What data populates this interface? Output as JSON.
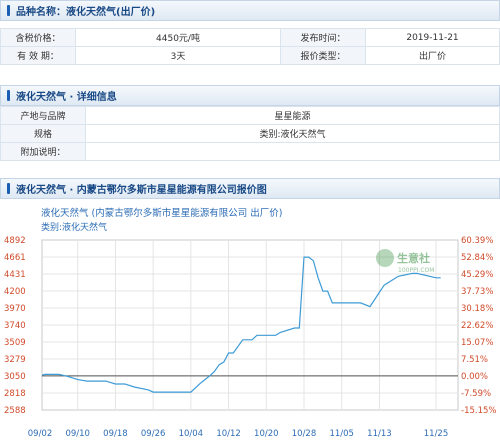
{
  "section1": {
    "title": "品种名称：液化天然气(出厂价)",
    "rows": [
      {
        "label1": "含税价格：",
        "value1": "4450元/吨",
        "label2": "发布时间：",
        "value2": "2019-11-21"
      },
      {
        "label1": "有 效 期：",
        "value1": "3天",
        "label2": "报价类型：",
        "value2": "出厂价"
      }
    ]
  },
  "section2": {
    "title": "液化天然气 · 详细信息",
    "rows": [
      {
        "label": "产地与品牌",
        "value": "星星能源"
      },
      {
        "label": "规格",
        "value": "类别:液化天然气"
      },
      {
        "label": "附加说明：",
        "value": ""
      }
    ]
  },
  "section3": {
    "title": "液化天然气 · 内蒙古鄂尔多斯市星星能源有限公司报价图"
  },
  "chart_data": {
    "type": "line",
    "title": "液化天然气 (内蒙古鄂尔多斯市星星能源有限公司 出厂价)",
    "subtitle": "类别:液化天然气",
    "watermark": "生意社",
    "watermark_url": "100PPI.COM",
    "x_ticks": [
      "09/02",
      "09/10",
      "09/18",
      "09/26",
      "10/04",
      "10/12",
      "10/20",
      "10/28",
      "11/05",
      "11/13",
      "11/25"
    ],
    "y_left_ticks": [
      "4892",
      "4661",
      "4431",
      "4200",
      "3970",
      "3740",
      "3509",
      "3279",
      "3050",
      "2818",
      "2588"
    ],
    "y_right_ticks": [
      "60.39%",
      "52.84%",
      "45.29%",
      "37.73%",
      "30.18%",
      "22.62%",
      "15.07%",
      "7.51%",
      "0.00%",
      "-7.59%",
      "-15.15%"
    ],
    "ylim": [
      2588,
      4892
    ],
    "series": [
      {
        "color": "#3d9bd6",
        "x": [
          "09/01",
          "09/03",
          "09/06",
          "09/08",
          "09/10",
          "09/12",
          "09/16",
          "09/18",
          "09/20",
          "09/22",
          "09/25",
          "09/26",
          "10/04",
          "10/06",
          "10/08",
          "10/09",
          "10/10",
          "10/11",
          "10/12",
          "10/13",
          "10/15",
          "10/17",
          "10/18",
          "10/22",
          "10/23",
          "10/26",
          "10/27",
          "10/28",
          "10/29",
          "10/30",
          "10/31",
          "11/01",
          "11/02",
          "11/03",
          "11/09",
          "11/11",
          "11/14",
          "11/17",
          "11/20",
          "11/21",
          "11/25",
          "11/26"
        ],
        "y": [
          3060,
          3070,
          3070,
          3040,
          3000,
          2980,
          2980,
          2940,
          2940,
          2900,
          2860,
          2830,
          2830,
          2950,
          3050,
          3110,
          3200,
          3240,
          3360,
          3360,
          3540,
          3540,
          3600,
          3600,
          3640,
          3700,
          3700,
          4660,
          4660,
          4610,
          4380,
          4200,
          4200,
          4040,
          4040,
          3990,
          4280,
          4400,
          4440,
          4440,
          4380,
          4380
        ]
      }
    ]
  },
  "colors": {
    "accent": "#1a5fb4",
    "left_axis_text": "#d04a2a",
    "right_axis_text": "#d04a2a",
    "line": "#3d9bd6"
  }
}
